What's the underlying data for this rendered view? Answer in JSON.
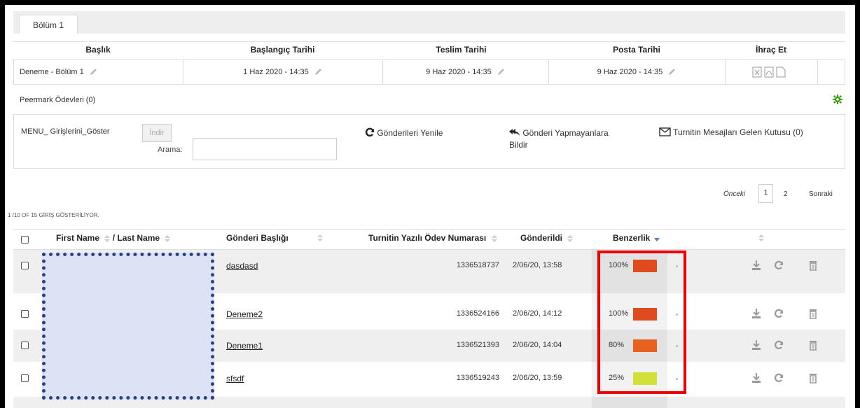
{
  "tabs": [
    {
      "label": "Bölüm 1"
    }
  ],
  "assignment_table": {
    "headers": [
      "Başlık",
      "Başlangıç Tarihi",
      "Teslim Tarihi",
      "Posta Tarihi",
      "İhraç Et"
    ],
    "row": {
      "title": "Deneme - Bölüm 1",
      "start": "1 Haz 2020 - 14:35",
      "due": "9 Haz 2020 - 14:35",
      "post": "9 Haz 2020 - 14:35"
    }
  },
  "peermark": {
    "label": "Peermark Ödevleri (0)"
  },
  "toolbar": {
    "menu_label": "MENU_ Girişlerini_Göster",
    "indir_label": "İndir",
    "search_label": "Arama:",
    "search_value": "",
    "refresh_label": "Gönderileri Yenile",
    "notify_label_1": "Gönderi Yapmayanlara",
    "notify_label_2": "Bildir",
    "inbox_label": "Turnitin Mesajları Gelen Kutusu (0)"
  },
  "pagination": {
    "prev": "Önceki",
    "pages": [
      "1",
      "2"
    ],
    "current": "1",
    "next": "Sonraki"
  },
  "summary": "1 /10 OF 15 GİRİŞ GÖSTERİLİYOR.",
  "columns": {
    "name_first": "First Name",
    "name_last": "/ Last Name",
    "title": "Gönderi Başlığı",
    "paper_id": "Turnitin Yazılı Ödev Numarası",
    "submitted": "Gönderildi",
    "similarity": "Benzerlik"
  },
  "rows": [
    {
      "title": "dasdasd",
      "paper_id": "1336518737",
      "submitted": "2/06/20, 13:58",
      "similarity": "100%",
      "color": "#e04a1f"
    },
    {
      "title": "Deneme2",
      "paper_id": "1336524166",
      "submitted": "2/06/20, 14:12",
      "similarity": "100%",
      "color": "#e04a1f"
    },
    {
      "title": "Deneme1",
      "paper_id": "1336521393",
      "submitted": "2/06/20, 14:04",
      "similarity": "80%",
      "color": "#e8621f"
    },
    {
      "title": "sfsdf",
      "paper_id": "1336519243",
      "submitted": "2/06/20, 13:59",
      "similarity": "25%",
      "color": "#d4e03a"
    }
  ],
  "colors": {
    "highlight_box": "#ee0000",
    "redacted_fill": "#dce3f5",
    "redacted_border": "#2a3f8a",
    "settings_green": "#3aa012"
  }
}
